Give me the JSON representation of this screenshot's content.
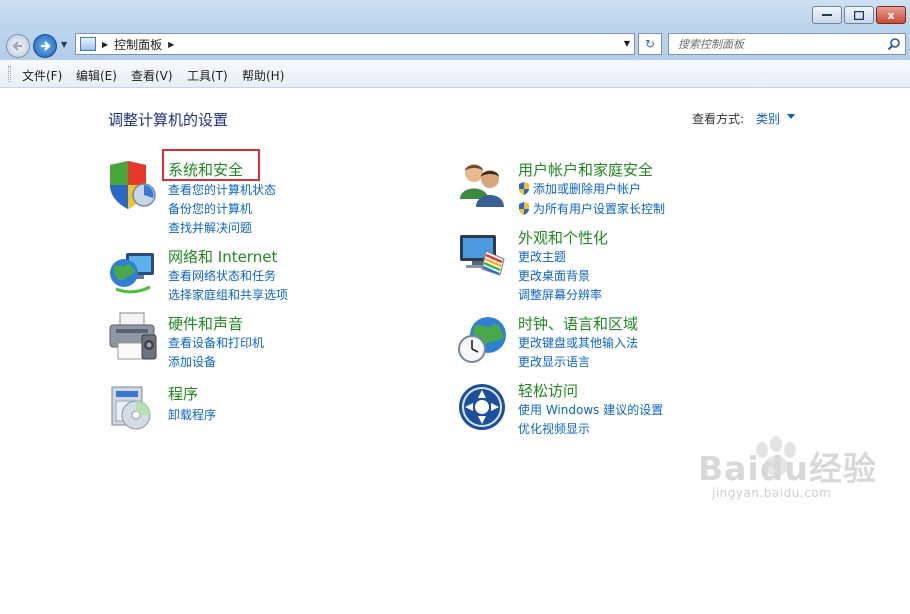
{
  "window": {
    "close_glyph": "x"
  },
  "address": {
    "breadcrumb": [
      "控制面板"
    ]
  },
  "search": {
    "placeholder": "搜索控制面板"
  },
  "menu": {
    "items": [
      "文件(F)",
      "编辑(E)",
      "查看(V)",
      "工具(T)",
      "帮助(H)"
    ]
  },
  "main": {
    "title": "调整计算机的设置",
    "view_label": "查看方式:",
    "view_value": "类别"
  },
  "categories": [
    {
      "title": "系统和安全",
      "icon": "shield-icon",
      "links": [
        "查看您的计算机状态",
        "备份您的计算机",
        "查找并解决问题"
      ]
    },
    {
      "title": "网络和 Internet",
      "icon": "network-icon",
      "links": [
        "查看网络状态和任务",
        "选择家庭组和共享选项"
      ]
    },
    {
      "title": "硬件和声音",
      "icon": "printer-icon",
      "links": [
        "查看设备和打印机",
        "添加设备"
      ]
    },
    {
      "title": "程序",
      "icon": "programs-icon",
      "links": [
        "卸载程序"
      ]
    },
    {
      "title": "用户帐户和家庭安全",
      "icon": "users-icon",
      "links": [
        "添加或删除用户帐户",
        "为所有用户设置家长控制"
      ]
    },
    {
      "title": "外观和个性化",
      "icon": "monitor-icon",
      "links": [
        "更改主题",
        "更改桌面背景",
        "调整屏幕分辨率"
      ]
    },
    {
      "title": "时钟、语言和区域",
      "icon": "globe-clock-icon",
      "links": [
        "更改键盘或其他输入法",
        "更改显示语言"
      ]
    },
    {
      "title": "轻松访问",
      "icon": "ease-of-access-icon",
      "links": [
        "使用 Windows 建议的设置",
        "优化视频显示"
      ]
    }
  ],
  "watermark": {
    "text": "Baidu经验",
    "url": "jingyan.baidu.com"
  },
  "colors": {
    "title_blue": "#1e3287",
    "category_green": "#1e8a1e",
    "link_blue": "#0d65c9",
    "highlight_red": "#e12d2d"
  }
}
